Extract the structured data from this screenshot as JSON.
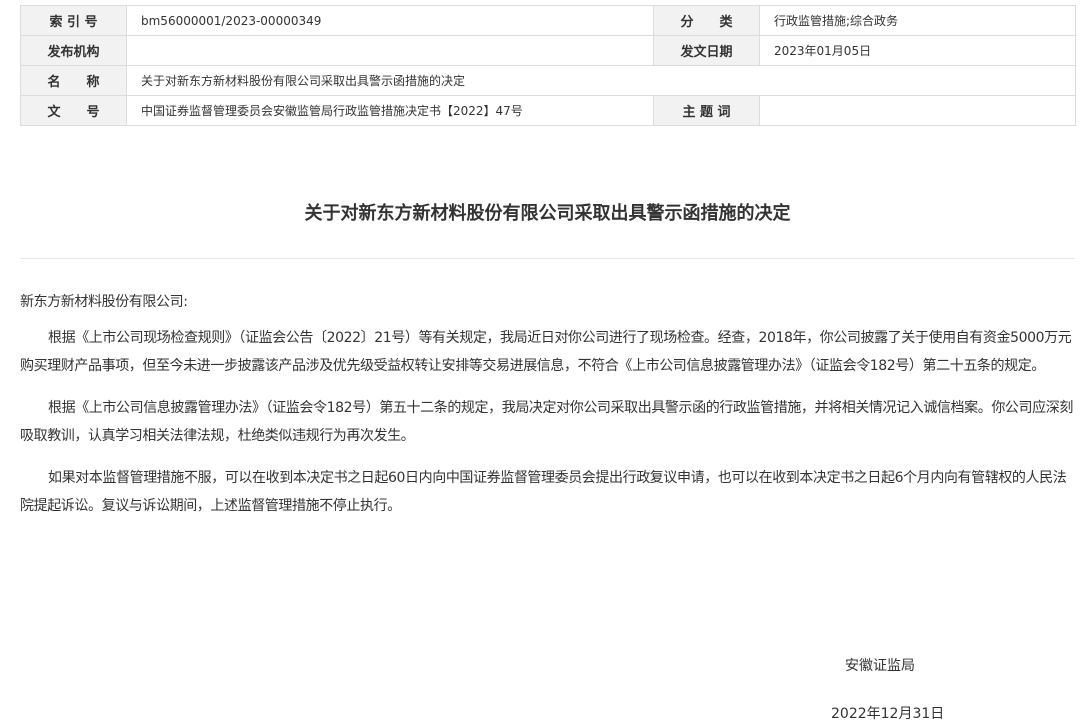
{
  "meta_table": {
    "index_label": "索 引 号",
    "index_value": "bm56000001/2023-00000349",
    "category_label": "分　　类",
    "category_value": "行政监管措施;综合政务",
    "publisher_label": "发布机构",
    "publisher_value": "",
    "date_label": "发文日期",
    "date_value": "2023年01月05日",
    "name_label": "名　　称",
    "name_value": "关于对新东方新材料股份有限公司采取出具警示函措施的决定",
    "docnum_label": "文　　号",
    "docnum_value": "中国证券监督管理委员会安徽监管局行政监管措施决定书【2022】47号",
    "subject_label": "主 题 词",
    "subject_value": ""
  },
  "document": {
    "title": "关于对新东方新材料股份有限公司采取出具警示函措施的决定",
    "salutation": "新东方新材料股份有限公司:",
    "paragraphs": [
      "根据《上市公司现场检查规则》（证监会公告〔2022〕21号）等有关规定，我局近日对你公司进行了现场检查。经查，2018年，你公司披露了关于使用自有资金5000万元购买理财产品事项，但至今未进一步披露该产品涉及优先级受益权转让安排等交易进展信息，不符合《上市公司信息披露管理办法》（证监会令182号）第二十五条的规定。",
      "根据《上市公司信息披露管理办法》（证监会令182号）第五十二条的规定，我局决定对你公司采取出具警示函的行政监管措施，并将相关情况记入诚信档案。你公司应深刻吸取教训，认真学习相关法律法规，杜绝类似违规行为再次发生。",
      "如果对本监督管理措施不服，可以在收到本决定书之日起60日内向中国证券监督管理委员会提出行政复议申请，也可以在收到本决定书之日起6个月内向有管辖权的人民法院提起诉讼。复议与诉讼期间，上述监督管理措施不停止执行。"
    ],
    "issuer": "安徽证监局",
    "issue_date": "2022年12月31日"
  }
}
